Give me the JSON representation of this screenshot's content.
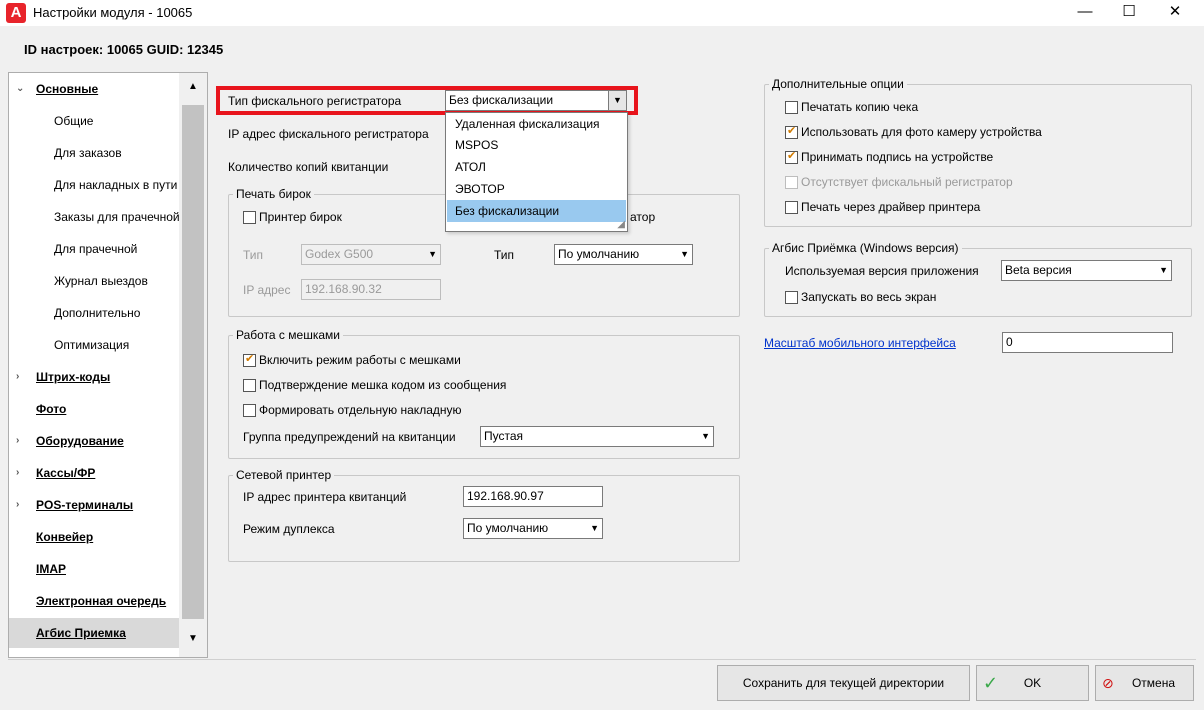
{
  "window": {
    "title": "Настройки модуля  - 10065",
    "logo_letter": "A",
    "minimize": "—",
    "maximize": "☐",
    "close": "✕"
  },
  "header": {
    "text": "ID настроек: 10065    GUID: 12345"
  },
  "tree": {
    "items": [
      {
        "label": "Основные"
      },
      {
        "label": "Общие"
      },
      {
        "label": "Для заказов"
      },
      {
        "label": "Для накладных в пути"
      },
      {
        "label": "Заказы для прачечной"
      },
      {
        "label": "Для прачечной"
      },
      {
        "label": "Журнал выездов"
      },
      {
        "label": "Дополнительно"
      },
      {
        "label": "Оптимизация"
      },
      {
        "label": "Штрих-коды"
      },
      {
        "label": "Фото"
      },
      {
        "label": "Оборудование"
      },
      {
        "label": "Кассы/ФР"
      },
      {
        "label": "POS-терминалы"
      },
      {
        "label": "Конвейер"
      },
      {
        "label": "IMAP"
      },
      {
        "label": "Электронная очередь"
      },
      {
        "label": "Агбис Приемка"
      }
    ]
  },
  "fiscal": {
    "type_label": "Тип фискального регистратора",
    "type_value": "Без фискализации",
    "ip_label": "IP адрес фискального регистратора",
    "copies_label": "Количество копий квитанции",
    "options": [
      "Удаленная фискализация",
      "MSPOS",
      "АТОЛ",
      "ЭВОТОР",
      "Без фискализации"
    ],
    "selected_option": "Без фискализации"
  },
  "tag_print": {
    "title": "Печать бирок",
    "printer_label": "Принтер бирок",
    "second_printer_label": "атор",
    "type_label": "Тип",
    "type_value": "Godex G500",
    "ip_label": "IP адрес",
    "ip_value": "192.168.90.32",
    "type2_label": "Тип",
    "type2_value": "По умолчанию"
  },
  "bags": {
    "title": "Работа с мешками",
    "enable_label": "Включить режим работы с мешками",
    "confirm_label": "Подтверждение мешка кодом из сообщения",
    "separate_label": "Формировать отдельную накладную",
    "warn_group_label": "Группа предупреждений на квитанции",
    "warn_group_value": "Пустая"
  },
  "net_printer": {
    "title": "Сетевой принтер",
    "ip_label": "IP адрес принтера квитанций",
    "ip_value": "192.168.90.97",
    "duplex_label": "Режим дуплекса",
    "duplex_value": "По умолчанию"
  },
  "extra": {
    "title": "Дополнительные опции",
    "print_copy": "Печатать копию чека",
    "use_camera": "Использовать для фото камеру устройства",
    "accept_signature": "Принимать подпись на устройстве",
    "no_fiscal": "Отсутствует фискальный регистратор",
    "print_driver": "Печать через драйвер принтера"
  },
  "agbis": {
    "title": "Агбис Приёмка (Windows версия)",
    "version_label": "Используемая версия приложения",
    "version_value": "Beta версия",
    "fullscreen_label": "Запускать во весь экран"
  },
  "mobile_scale": {
    "label": "Масштаб мобильного интерфейса",
    "value": "0"
  },
  "buttons": {
    "save": "Сохранить для текущей директории",
    "ok": "OK",
    "cancel": "Отмена"
  },
  "colors": {
    "highlight": "#e8141c",
    "selection": "#99c9ef",
    "link": "#0033cc",
    "check": "#d07a00"
  }
}
